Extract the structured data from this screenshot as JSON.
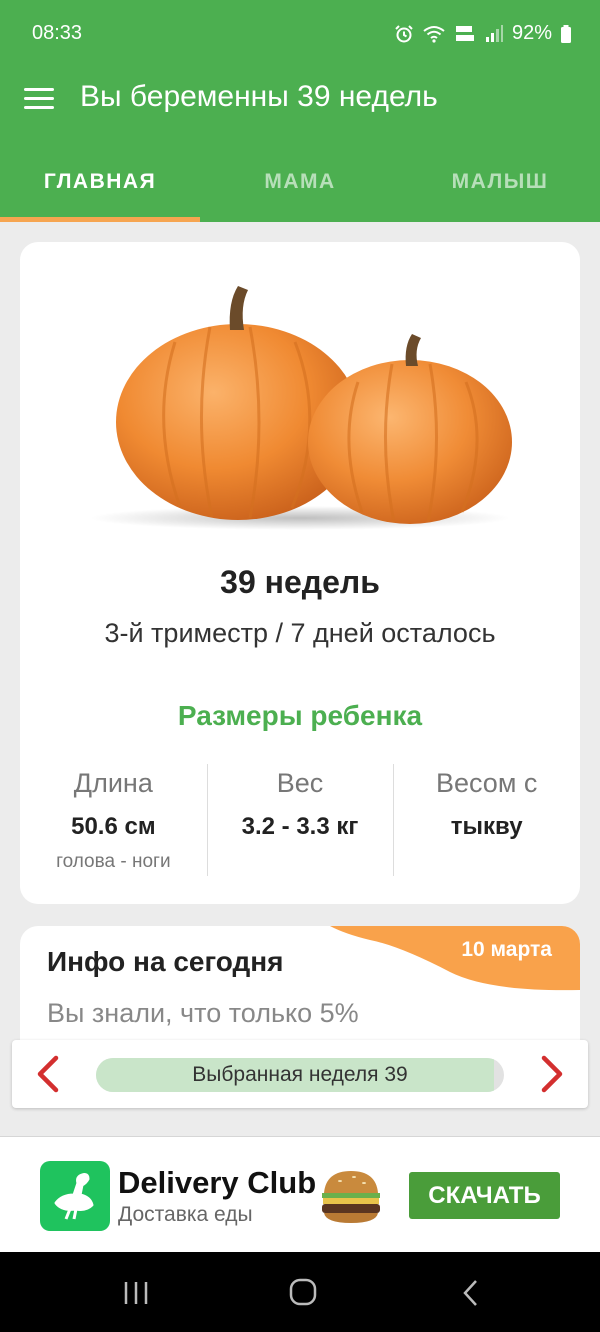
{
  "status_bar": {
    "time": "08:33",
    "battery": "92%"
  },
  "app_bar": {
    "title": "Вы беременны 39 недель",
    "menu_icon": "hamburger-menu-icon"
  },
  "tabs": [
    {
      "label": "ГЛАВНАЯ",
      "active": true
    },
    {
      "label": "МАМА",
      "active": false
    },
    {
      "label": "МАЛЫШ",
      "active": false
    }
  ],
  "main_card": {
    "image": "pumpkins-image",
    "week_title": "39 недель",
    "subtitle": "3-й триместр / 7 дней осталось",
    "sizes_title": "Размеры ребенка",
    "stats": [
      {
        "label": "Длина",
        "value": "50.6 см",
        "note": "голова - ноги"
      },
      {
        "label": "Вес",
        "value": "3.2 - 3.3 кг",
        "note": ""
      },
      {
        "label": "Весом с",
        "value": "тыкву",
        "note": ""
      }
    ]
  },
  "info_card": {
    "title": "Инфо на сегодня",
    "date": "10 марта",
    "text": "Вы знали, что только 5%"
  },
  "week_selector": {
    "label": "Выбранная неделя 39",
    "progress": 0.975,
    "prev_icon": "chevron-left-icon",
    "next_icon": "chevron-right-icon"
  },
  "ad": {
    "brand": "Delivery Club",
    "subtitle": "Доставка еды",
    "cta": "СКАЧАТЬ",
    "logo_icon": "ostrich-icon",
    "image": "burger-image"
  },
  "colors": {
    "primary_green": "#4caf50",
    "tab_indicator": "#f6a550",
    "arrow_red": "#d32f2f",
    "ad_green": "#1fc35e",
    "cta_green": "#4a9d3a"
  }
}
